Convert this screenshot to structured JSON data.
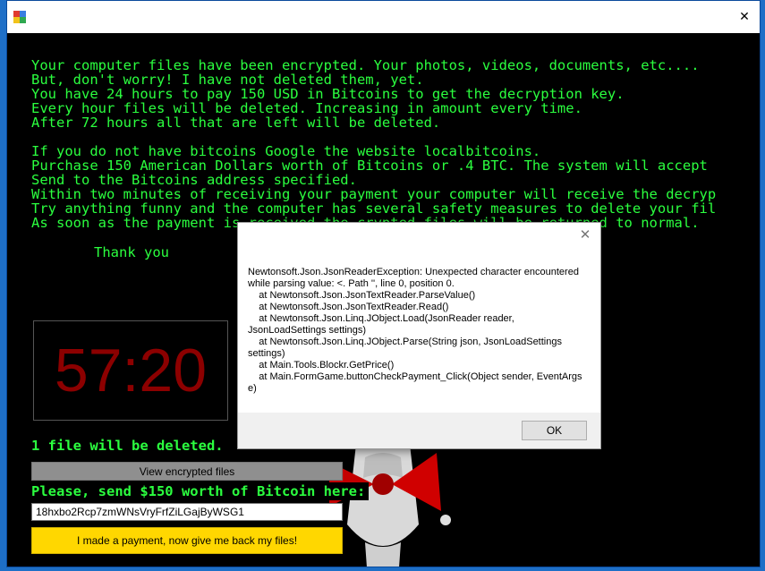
{
  "window": {
    "close_glyph": "✕",
    "app_icon_colors": [
      "#e03a2f",
      "#3a7de0",
      "#f2c31b",
      "#2fa84f"
    ]
  },
  "ransom": {
    "lines": [
      "Your computer files have been encrypted. Your photos, videos, documents, etc....",
      "But, don't worry! I have not deleted them, yet.",
      "You have 24 hours to pay 150 USD in Bitcoins to get the decryption key.",
      "Every hour files will be deleted. Increasing in amount every time.",
      "After 72 hours all that are left will be deleted.",
      "",
      "If you do not have bitcoins Google the website localbitcoins.",
      "Purchase 150 American Dollars worth of Bitcoins or .4 BTC. The system will accept",
      "Send to the Bitcoins address specified.",
      "Within two minutes of receiving your payment your computer will receive the decryp",
      "Try anything funny and the computer has several safety measures to delete your fil",
      "As soon as the payment is received the crypted files will be returned to normal."
    ],
    "thanks": "Thank you"
  },
  "timer": {
    "value": "57:20",
    "color": "#8c0000"
  },
  "status": {
    "deleted_label": "1 file will be deleted."
  },
  "buttons": {
    "view_files": "View encrypted files",
    "pay": "I made a payment, now give me back my files!"
  },
  "payment": {
    "send_label": "Please, send $150 worth of Bitcoin here:",
    "address": "18hxbo2Rcp7zmWNsVryFrfZiLGajByWSG1"
  },
  "dialog": {
    "close_glyph": "✕",
    "message": "Newtonsoft.Json.JsonReaderException: Unexpected character encountered while parsing value: <. Path '', line 0, position 0.\n    at Newtonsoft.Json.JsonTextReader.ParseValue()\n    at Newtonsoft.Json.JsonTextReader.Read()\n    at Newtonsoft.Json.Linq.JObject.Load(JsonReader reader, JsonLoadSettings settings)\n    at Newtonsoft.Json.Linq.JObject.Parse(String json, JsonLoadSettings settings)\n    at Main.Tools.Blockr.GetPrice()\n    at Main.FormGame.buttonCheckPayment_Click(Object sender, EventArgs e)",
    "ok_label": "OK"
  },
  "colors": {
    "text_green": "#2bff3f",
    "background": "#000000",
    "pay_button": "#ffd700"
  }
}
